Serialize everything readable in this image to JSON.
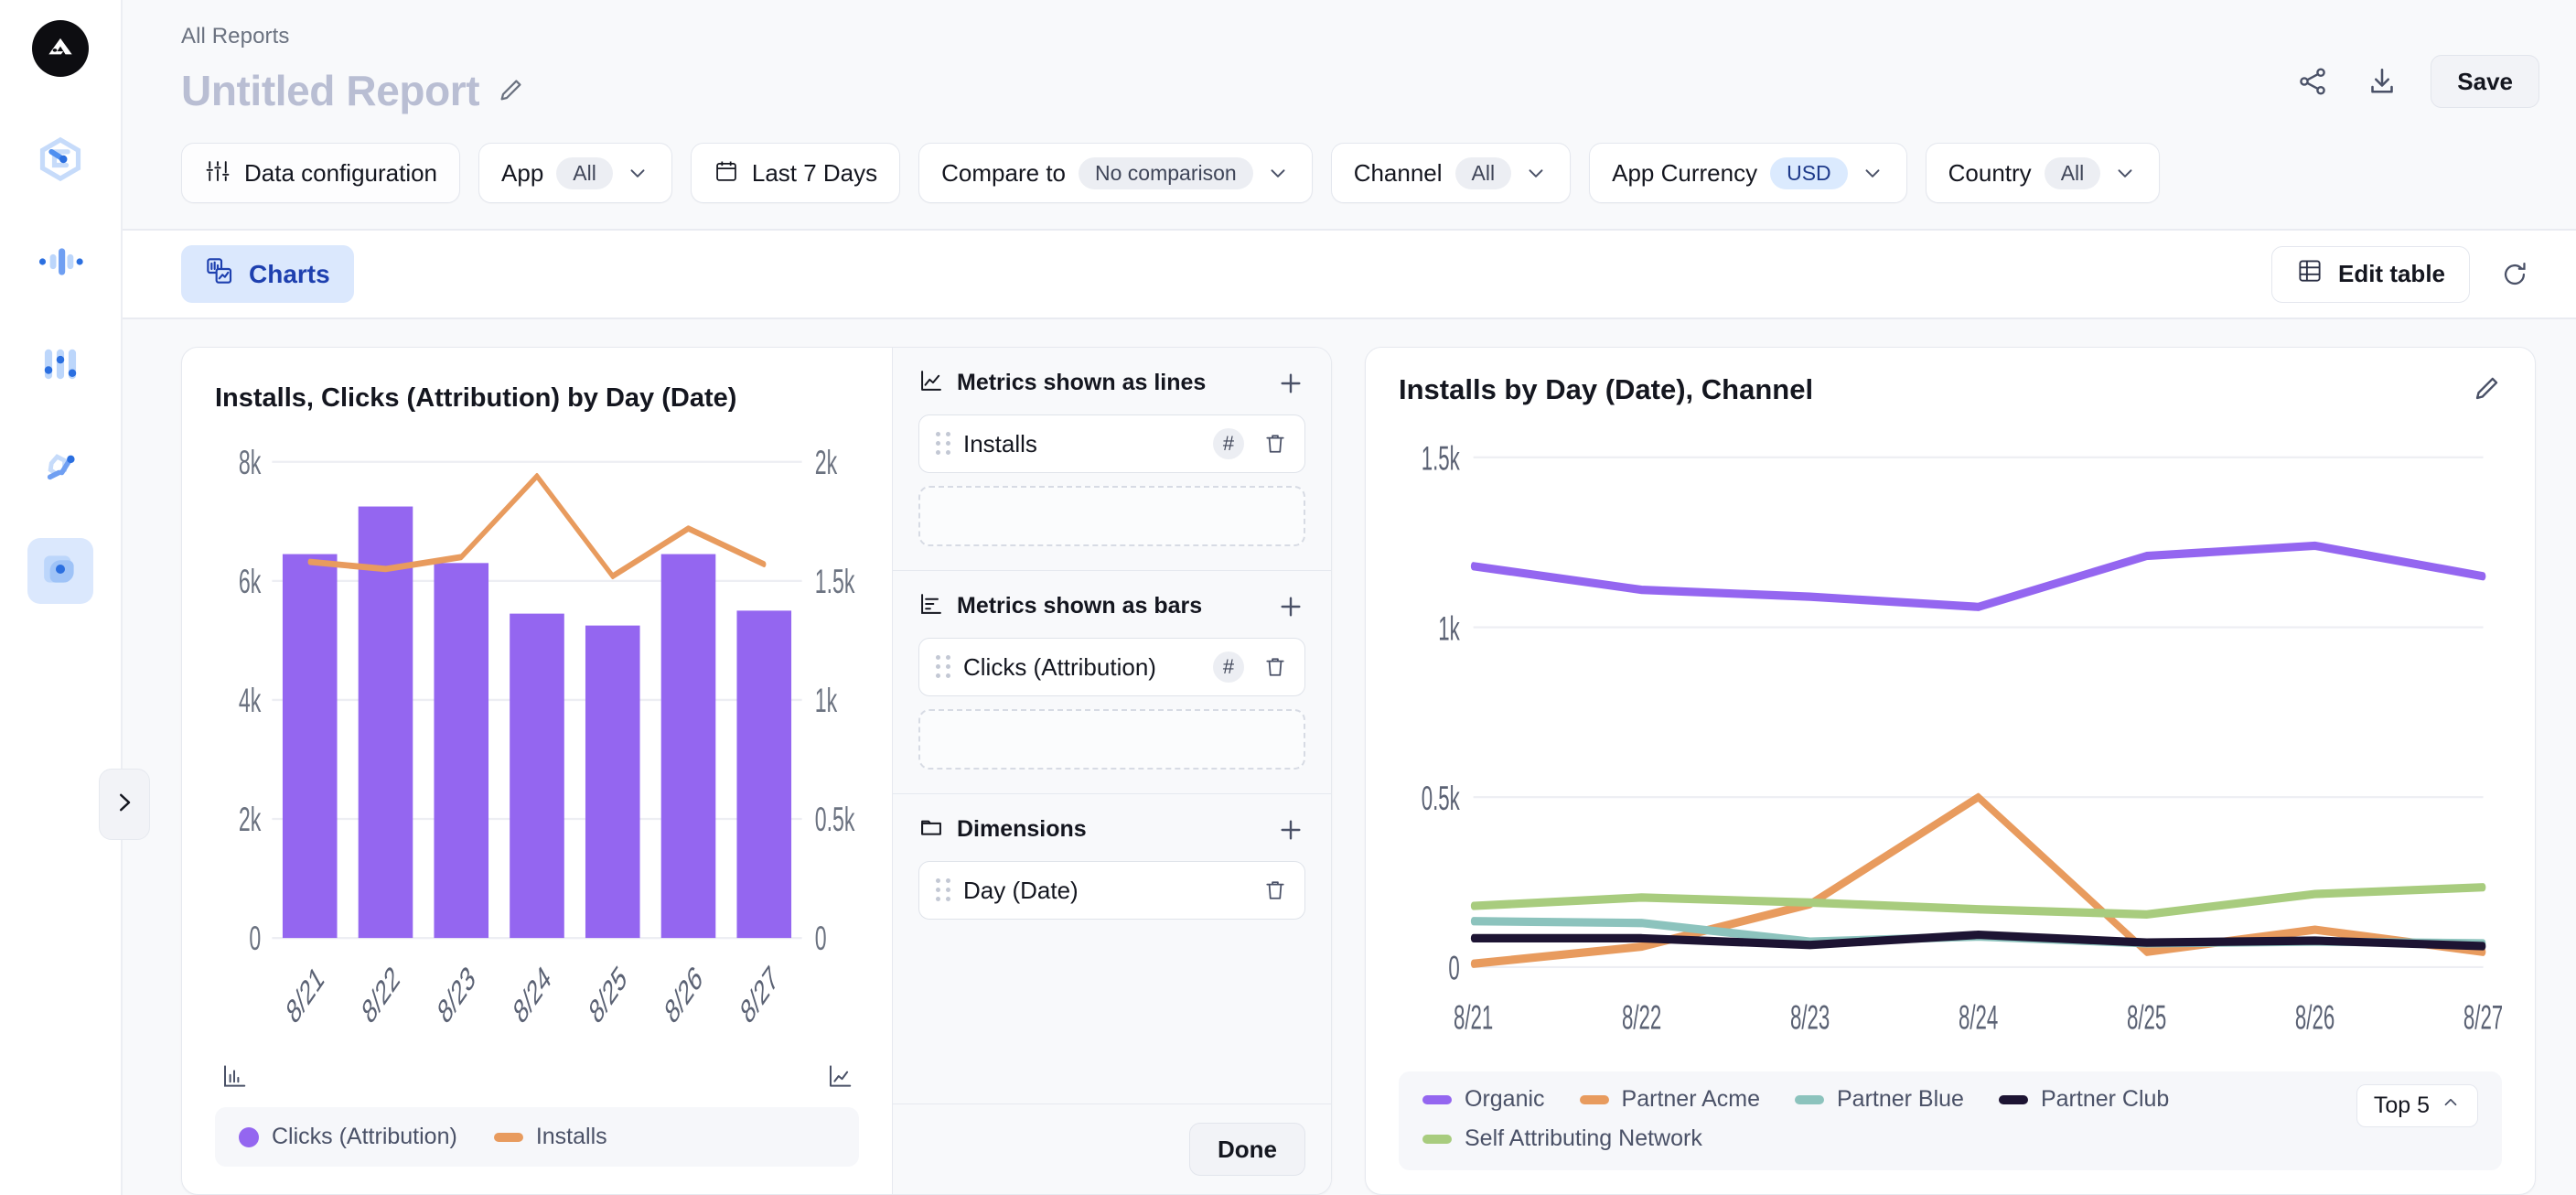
{
  "app": {
    "brand_dark": "#0d0d11",
    "accent_blue": "#1e40af",
    "rail_items": [
      "logo-icon",
      "hexagon-s-icon",
      "audio-wave-icon",
      "sliders-icon",
      "chain-links-icon",
      "layers-target-icon"
    ]
  },
  "header": {
    "breadcrumb": "All Reports",
    "title": "Untitled Report",
    "edit_title_icon": "pencil-icon",
    "share_icon": "share-icon",
    "download_icon": "download-icon",
    "save_label": "Save"
  },
  "filters": [
    {
      "id": "data-configuration",
      "icon": "sliders-icon",
      "label": "Data configuration",
      "value": null,
      "chevron": false
    },
    {
      "id": "app",
      "icon": null,
      "label": "App",
      "value": "All",
      "chevron": true
    },
    {
      "id": "date-range",
      "icon": "calendar-icon",
      "label": "Last 7 Days",
      "value": null,
      "chevron": false
    },
    {
      "id": "compare-to",
      "icon": null,
      "label": "Compare to",
      "value": "No comparison",
      "chevron": true
    },
    {
      "id": "channel",
      "icon": null,
      "label": "Channel",
      "value": "All",
      "chevron": true
    },
    {
      "id": "app-currency",
      "icon": null,
      "label": "App Currency",
      "value": "USD",
      "value_accent": true,
      "chevron": true
    },
    {
      "id": "country",
      "icon": null,
      "label": "Country",
      "value": "All",
      "chevron": true
    }
  ],
  "toolbar": {
    "charts_tab": "Charts",
    "charts_icon": "charts-icon",
    "edit_table_label": "Edit table",
    "edit_table_icon": "table-icon",
    "refresh_icon": "refresh-icon"
  },
  "collapse_handle_icon": "chevron-right-icon",
  "builder": {
    "sections": [
      {
        "id": "metrics-lines",
        "icon": "line-chart-icon",
        "title": "Metrics shown as lines",
        "add_icon": "plus-icon",
        "items": [
          {
            "label": "Installs",
            "badge": "#",
            "delete_icon": "trash-icon"
          }
        ],
        "has_dropzone": true
      },
      {
        "id": "metrics-bars",
        "icon": "bar-chart-icon",
        "title": "Metrics shown as bars",
        "add_icon": "plus-icon",
        "items": [
          {
            "label": "Clicks (Attribution)",
            "badge": "#",
            "delete_icon": "trash-icon"
          }
        ],
        "has_dropzone": true
      },
      {
        "id": "dimensions",
        "icon": "folder-icon",
        "title": "Dimensions",
        "add_icon": "plus-icon",
        "items": [
          {
            "label": "Day (Date)",
            "badge": null,
            "delete_icon": "trash-icon"
          }
        ],
        "has_dropzone": false
      }
    ],
    "done_label": "Done"
  },
  "chart_data": [
    {
      "id": "left-combo-chart",
      "type": "bar",
      "title": "Installs, Clicks (Attribution) by Day (Date)",
      "categories": [
        "8/21",
        "8/22",
        "8/23",
        "8/24",
        "8/25",
        "8/26",
        "8/27"
      ],
      "xlabel": "",
      "grid": true,
      "legend_position": "bottom",
      "left_axis": {
        "name": "Clicks (Attribution)",
        "ylabel": "",
        "ylim": [
          0,
          8000
        ],
        "ticks": [
          0,
          2000,
          4000,
          6000,
          8000
        ],
        "tick_labels": [
          "0",
          "2k",
          "4k",
          "6k",
          "8k"
        ],
        "icon": "bar-axis-icon"
      },
      "right_axis": {
        "name": "Installs",
        "ylabel": "",
        "ylim": [
          0,
          2000
        ],
        "ticks": [
          0,
          500,
          1000,
          1500,
          2000
        ],
        "tick_labels": [
          "0",
          "0.5k",
          "1k",
          "1.5k",
          "2k"
        ],
        "icon": "line-axis-icon"
      },
      "series": [
        {
          "name": "Clicks (Attribution)",
          "kind": "bar",
          "axis": "left",
          "color": "#9466f0",
          "values": [
            6450,
            7250,
            6300,
            5450,
            5250,
            6450,
            5500
          ]
        },
        {
          "name": "Installs",
          "kind": "line",
          "axis": "right",
          "color": "#e89b5e",
          "values": [
            1580,
            1550,
            1600,
            1940,
            1520,
            1720,
            1570
          ]
        }
      ],
      "legend": [
        {
          "label": "Clicks (Attribution)",
          "color": "#9466f0",
          "marker": "dot"
        },
        {
          "label": "Installs",
          "color": "#e89b5e",
          "marker": "bar"
        }
      ]
    },
    {
      "id": "right-line-chart",
      "type": "line",
      "title": "Installs by Day (Date), Channel",
      "edit_icon": "pencil-icon",
      "categories": [
        "8/21",
        "8/22",
        "8/23",
        "8/24",
        "8/25",
        "8/26",
        "8/27"
      ],
      "xlabel": "",
      "ylabel": "",
      "ylim": [
        0,
        1500
      ],
      "ticks": [
        0,
        500,
        1000,
        1500
      ],
      "tick_labels": [
        "0",
        "0.5k",
        "1k",
        "1.5k"
      ],
      "grid": true,
      "legend_position": "bottom",
      "top_selector": "Top 5",
      "top_selector_icon": "chevron-up-icon",
      "series": [
        {
          "name": "Organic",
          "color": "#9466f0",
          "values": [
            1180,
            1110,
            1090,
            1060,
            1210,
            1240,
            1150
          ]
        },
        {
          "name": "Partner Acme",
          "color": "#e89b5e",
          "values": [
            10,
            60,
            185,
            500,
            45,
            110,
            45
          ]
        },
        {
          "name": "Partner Blue",
          "color": "#8cc3bd",
          "values": [
            135,
            130,
            75,
            90,
            70,
            75,
            70
          ]
        },
        {
          "name": "Partner Club",
          "color": "#1d1433",
          "values": [
            85,
            85,
            65,
            95,
            72,
            78,
            62
          ]
        },
        {
          "name": "Self Attributing Network",
          "color": "#a8cc7e",
          "values": [
            180,
            205,
            190,
            170,
            155,
            215,
            235
          ]
        }
      ],
      "legend": [
        {
          "label": "Organic",
          "color": "#9466f0"
        },
        {
          "label": "Partner Acme",
          "color": "#e89b5e"
        },
        {
          "label": "Partner Blue",
          "color": "#8cc3bd"
        },
        {
          "label": "Partner Club",
          "color": "#1d1433"
        },
        {
          "label": "Self Attributing Network",
          "color": "#a8cc7e"
        }
      ]
    }
  ]
}
